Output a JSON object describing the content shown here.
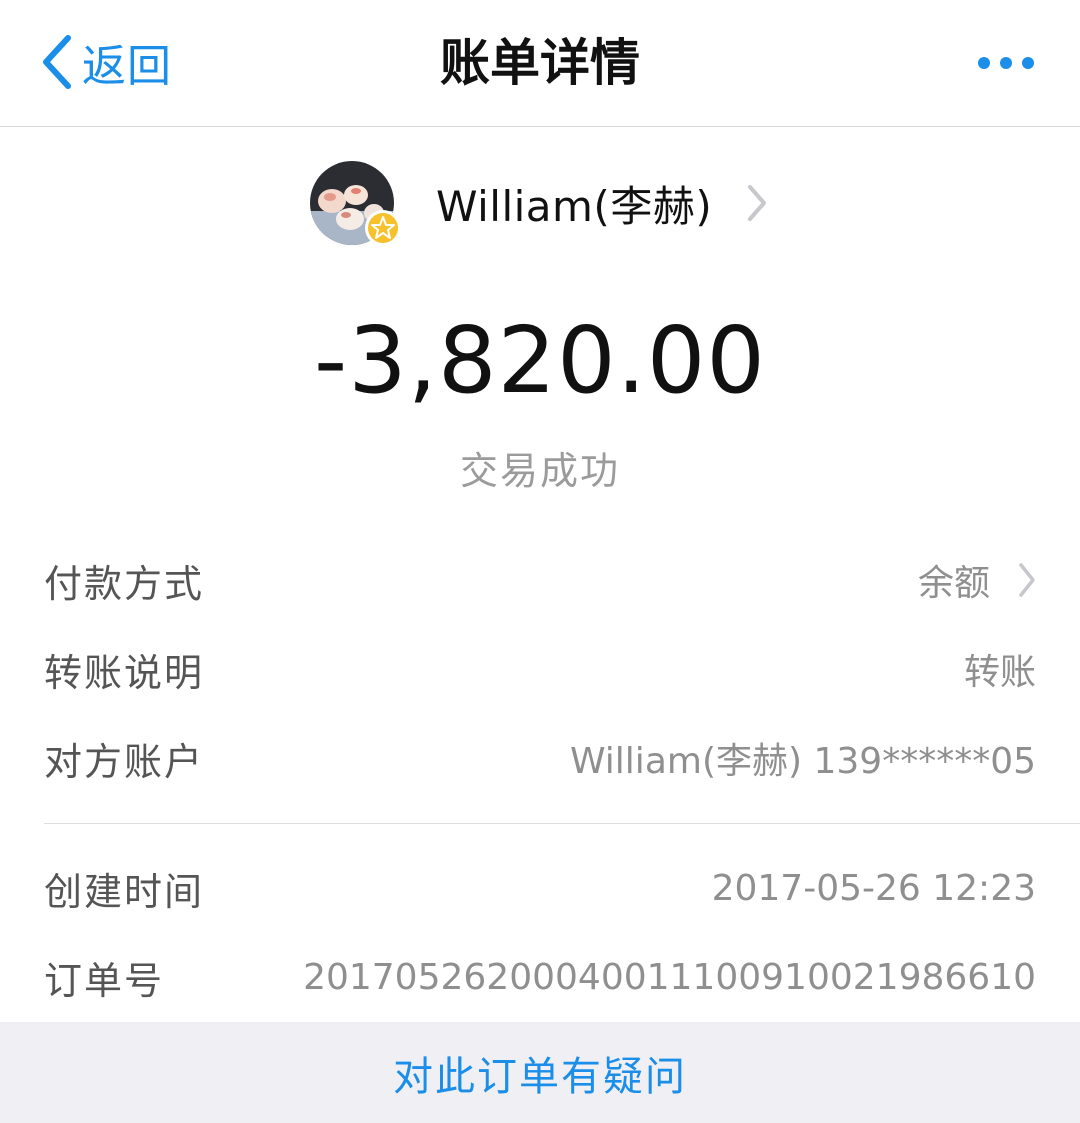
{
  "nav": {
    "back_label": "返回",
    "title": "账单详情",
    "back_icon": "chevron-left-icon",
    "more_icon": "more-icon",
    "accent_color": "#1a8ee8"
  },
  "payee": {
    "name": "William(李赫)",
    "avatar_icon": "avatar",
    "badge_icon": "star-badge-icon",
    "chevron_icon": "chevron-right-icon"
  },
  "transaction": {
    "amount": "-3,820.00",
    "status": "交易成功"
  },
  "details": [
    {
      "label": "付款方式",
      "value": "余额",
      "has_chevron": true
    },
    {
      "label": "转账说明",
      "value": "转账",
      "has_chevron": false
    },
    {
      "label": "对方账户",
      "value": "William(李赫) 139******05",
      "has_chevron": false
    },
    {
      "label": "创建时间",
      "value": "2017-05-26 12:23",
      "has_chevron": false
    },
    {
      "label": "订单号",
      "value": "20170526200040011100910021986610",
      "has_chevron": false
    }
  ],
  "footer": {
    "link_label": "对此订单有疑问"
  }
}
